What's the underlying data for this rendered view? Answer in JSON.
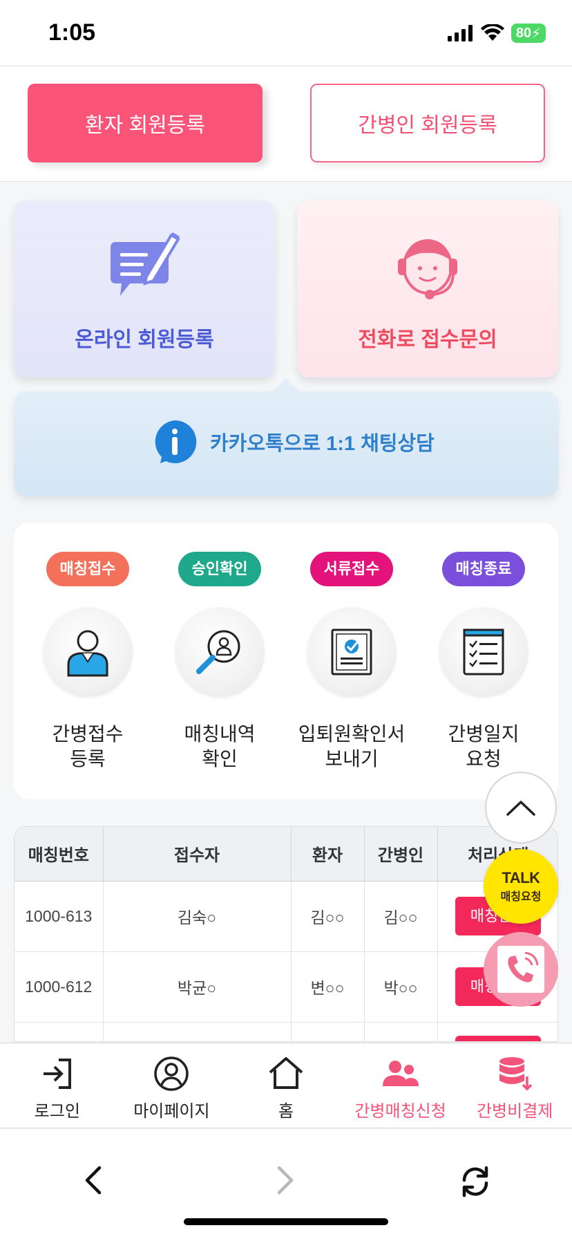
{
  "status_bar": {
    "time": "1:05",
    "battery": "80"
  },
  "register": {
    "patient_label": "환자 회원등록",
    "caregiver_label": "간병인 회원등록"
  },
  "cards": {
    "online_label": "온라인 회원등록",
    "phone_label": "전화로 접수문의"
  },
  "kakao": {
    "label": "카카오톡으로 1:1 채팅상담"
  },
  "steps": [
    {
      "badge": "매칭접수",
      "badge_color": "#f3705a",
      "label": "간병접수\n등록"
    },
    {
      "badge": "승인확인",
      "badge_color": "#1fa98a",
      "label": "매칭내역\n확인"
    },
    {
      "badge": "서류접수",
      "badge_color": "#e3137b",
      "label": "입퇴원확인서\n보내기"
    },
    {
      "badge": "매칭종료",
      "badge_color": "#7a4fdc",
      "label": "간병일지\n요청"
    }
  ],
  "table": {
    "headers": [
      "매칭번호",
      "접수자",
      "환자",
      "간병인",
      "처리상태"
    ],
    "rows": [
      {
        "id": "1000-613",
        "receiver": "김숙○",
        "patient": "김○○",
        "caregiver": "김○○",
        "status": "매칭완료"
      },
      {
        "id": "1000-612",
        "receiver": "박균○",
        "patient": "변○○",
        "caregiver": "박○○",
        "status": "매칭완료"
      },
      {
        "id": "",
        "receiver": "",
        "patient": "",
        "caregiver": "",
        "status": ""
      }
    ]
  },
  "floating": {
    "talk_title": "TALK",
    "talk_sub": "매칭요청"
  },
  "bottom_nav": [
    {
      "label": "로그인",
      "icon": "login-icon"
    },
    {
      "label": "마이페이지",
      "icon": "user-icon"
    },
    {
      "label": "홈",
      "icon": "home-icon"
    },
    {
      "label": "간병매칭신청",
      "icon": "people-icon"
    },
    {
      "label": "간병비결제",
      "icon": "database-icon"
    }
  ],
  "colors": {
    "accent_pink": "#fb5479",
    "online_blue": "#4d5bd6",
    "phone_red": "#f04a5e",
    "kakao_blue": "#2f7fcb"
  }
}
